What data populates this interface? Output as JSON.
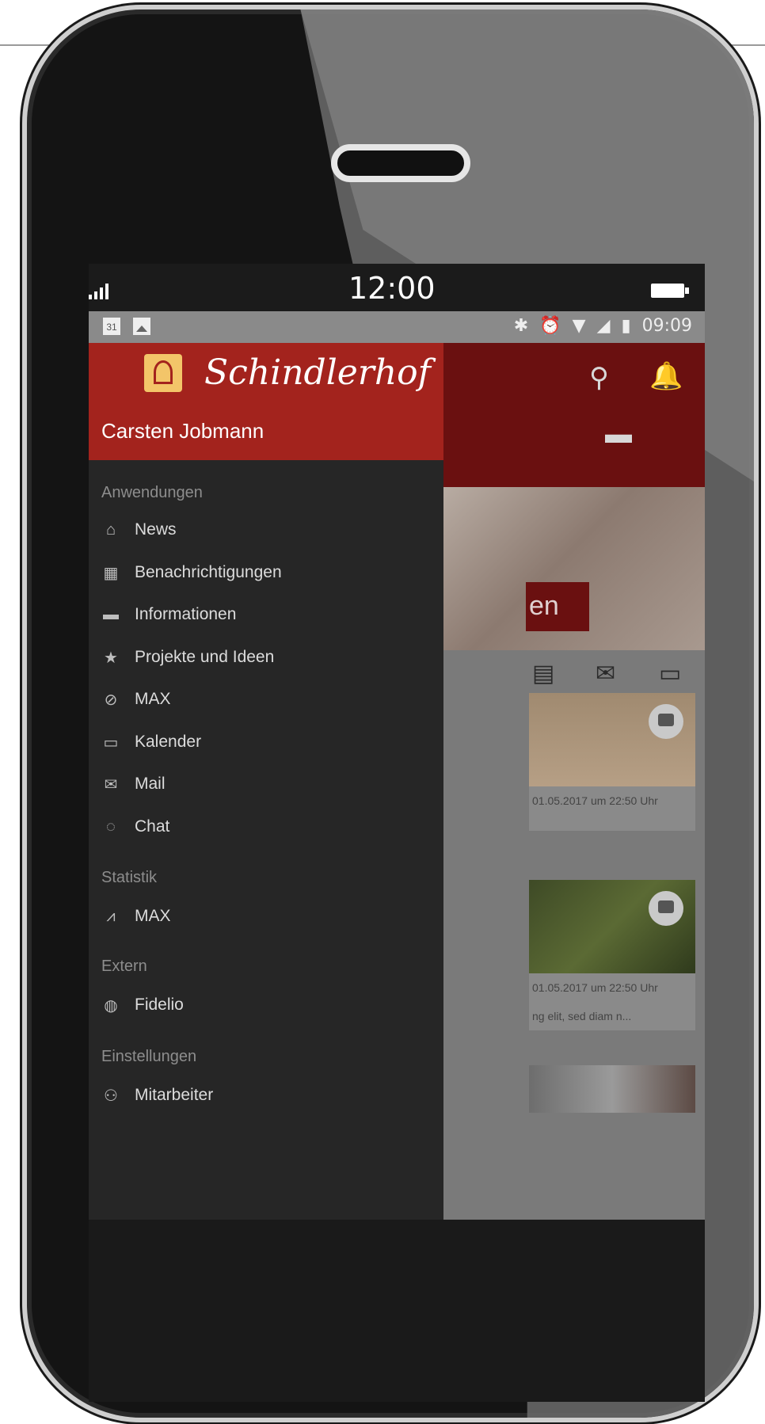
{
  "phone": {
    "status_time": "12:00",
    "android_status": {
      "calendar_day": "31",
      "time": "09:09"
    }
  },
  "brand": {
    "logo_text": "Schindlerhof"
  },
  "user": {
    "name": "Carsten Jobmann"
  },
  "drawer": {
    "sections": [
      {
        "title": "Anwendungen",
        "items": [
          {
            "label": "News",
            "icon": "home-icon"
          },
          {
            "label": "Benachrichtigungen",
            "icon": "notifications-icon"
          },
          {
            "label": "Informationen",
            "icon": "folder-icon"
          },
          {
            "label": "Projekte und Ideen",
            "icon": "star-icon"
          },
          {
            "label": "MAX",
            "icon": "check-circle-icon"
          },
          {
            "label": "Kalender",
            "icon": "calendar-icon"
          },
          {
            "label": "Mail",
            "icon": "mail-icon"
          },
          {
            "label": "Chat",
            "icon": "chat-icon"
          }
        ]
      },
      {
        "title": "Statistik",
        "items": [
          {
            "label": "MAX",
            "icon": "chart-icon"
          }
        ]
      },
      {
        "title": "Extern",
        "items": [
          {
            "label": "Fidelio",
            "icon": "globe-icon"
          }
        ]
      },
      {
        "title": "Einstellungen",
        "items": [
          {
            "label": "Mitarbeiter",
            "icon": "people-icon"
          }
        ]
      }
    ]
  },
  "background_app": {
    "photo_label": "en",
    "cards": [
      {
        "meta": "01.05.2017 um 22:50 Uhr",
        "snippet": ""
      },
      {
        "meta": "01.05.2017 um 22:50 Uhr",
        "snippet": "ng elit, sed diam n..."
      }
    ]
  },
  "colors": {
    "header_red": "#a3231d",
    "drawer_bg": "#262626",
    "logo_gold": "#f3c569"
  }
}
